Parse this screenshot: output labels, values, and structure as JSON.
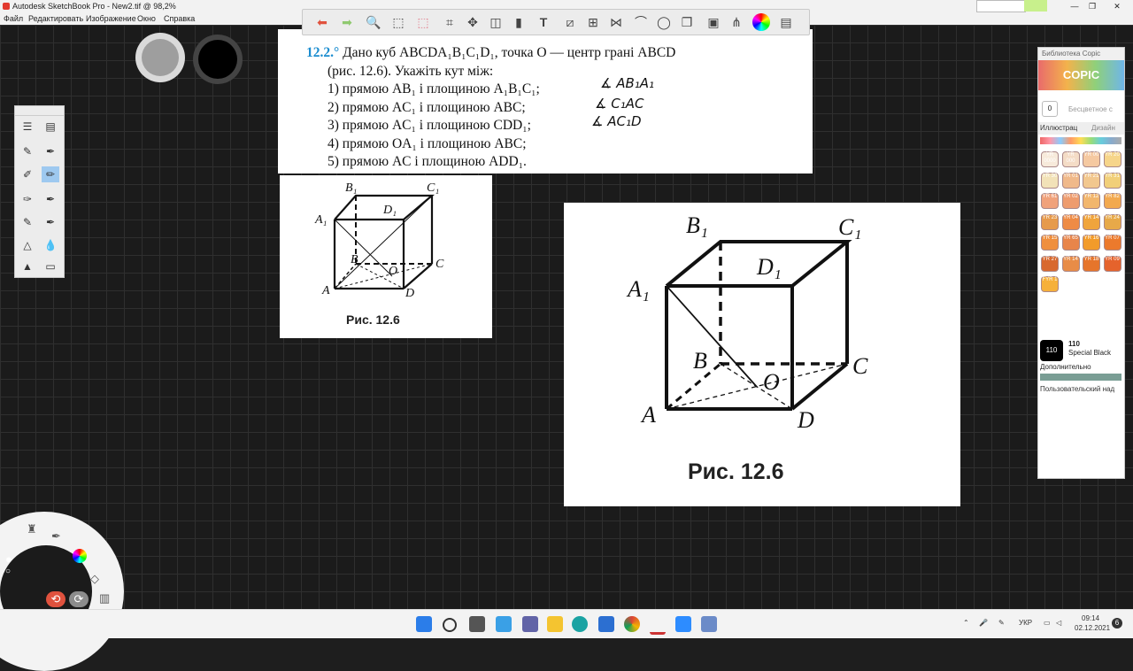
{
  "window": {
    "title": "Autodesk SketchBook Pro - New2.tif @ 98,2%",
    "min": "—",
    "max": "❐",
    "close": "✕"
  },
  "menu": [
    "Файл",
    "Редактировать",
    "Изображение",
    "Окно",
    "Справка"
  ],
  "toolbar_icons": [
    "undo-icon",
    "redo-icon",
    "zoom-icon",
    "select-icon",
    "lasso-icon",
    "crop-icon",
    "transform-icon",
    "distort-icon",
    "fill-icon",
    "text-icon",
    "ruler-icon",
    "perspective-icon",
    "symmetry-icon",
    "curve-icon",
    "ellipse-icon",
    "layers-icon",
    "copy-icon",
    "copic-icon",
    "color-wheel-icon",
    "brushes-icon"
  ],
  "problem": {
    "number": "12.2.°",
    "intro": "Дано куб ABCDA₁B₁C₁D₁, точка O — центр грані ABCD",
    "intro2": "(рис. 12.6). Укажіть кут між:",
    "items": [
      "1) прямою AB₁ і площиною A₁B₁C₁;",
      "2) прямою AC₁ і площиною ABC;",
      "3) прямою AC₁ і площиною CDD₁;",
      "4) прямою OA₁ і площиною ABC;",
      "5) прямою AC і площиною ADD₁."
    ],
    "handwriting": [
      "∡ AB₁A₁",
      "∡ C₁AC",
      "∡ AC₁D"
    ]
  },
  "figure": {
    "caption": "Рис. 12.6",
    "labels": {
      "A": "A",
      "B": "B",
      "C": "C",
      "D": "D",
      "A1": "A₁",
      "B1": "B₁",
      "C1": "C₁",
      "D1": "D₁",
      "O": "O"
    }
  },
  "copic": {
    "header": "Библиотека Copic",
    "logo": "COPIC",
    "field_label": "Бесцветное с",
    "tab_illustration": "Иллюстрац",
    "tab_design": "Дизайн",
    "swatches": [
      {
        "code": "YR 0000",
        "color": "#f7eadb"
      },
      {
        "code": "YR 000",
        "color": "#f4dcc6"
      },
      {
        "code": "YR 00",
        "color": "#f5c9a1"
      },
      {
        "code": "YR 20",
        "color": "#f6d58a"
      },
      {
        "code": "YR 30",
        "color": "#f2e2b8"
      },
      {
        "code": "YR 01",
        "color": "#f0b98a"
      },
      {
        "code": "YR 21",
        "color": "#f2c78e"
      },
      {
        "code": "YR 31",
        "color": "#f1cf79"
      },
      {
        "code": "YR 61",
        "color": "#f0a27b"
      },
      {
        "code": "YR 02",
        "color": "#ee9c6e"
      },
      {
        "code": "YR 12",
        "color": "#f2b66d"
      },
      {
        "code": "YR 82",
        "color": "#f2a94f"
      },
      {
        "code": "YR 23",
        "color": "#e69a4c"
      },
      {
        "code": "YR 04",
        "color": "#ee8b45"
      },
      {
        "code": "YR 14",
        "color": "#f0a43c"
      },
      {
        "code": "YR 24",
        "color": "#e7a949"
      },
      {
        "code": "YR 15",
        "color": "#ef8f3e"
      },
      {
        "code": "YR 65",
        "color": "#e8854a"
      },
      {
        "code": "YR 16",
        "color": "#f29b2a"
      },
      {
        "code": "YR 07",
        "color": "#ec7a2c"
      },
      {
        "code": "YR 27",
        "color": "#d8692f"
      },
      {
        "code": "YR 14",
        "color": "#e88c47"
      },
      {
        "code": "YR 18",
        "color": "#e6752b"
      },
      {
        "code": "YR 09",
        "color": "#e5632c"
      },
      {
        "code": "FYR 1",
        "color": "#f6b03a"
      }
    ],
    "selected_code": "110",
    "selected_name": "Special Black",
    "more": "Дополнительно",
    "custom": "Пользовательский над"
  },
  "taskbar": {
    "lang": "УКР",
    "time": "09:14",
    "date": "02.12.2021",
    "notify": "6"
  }
}
